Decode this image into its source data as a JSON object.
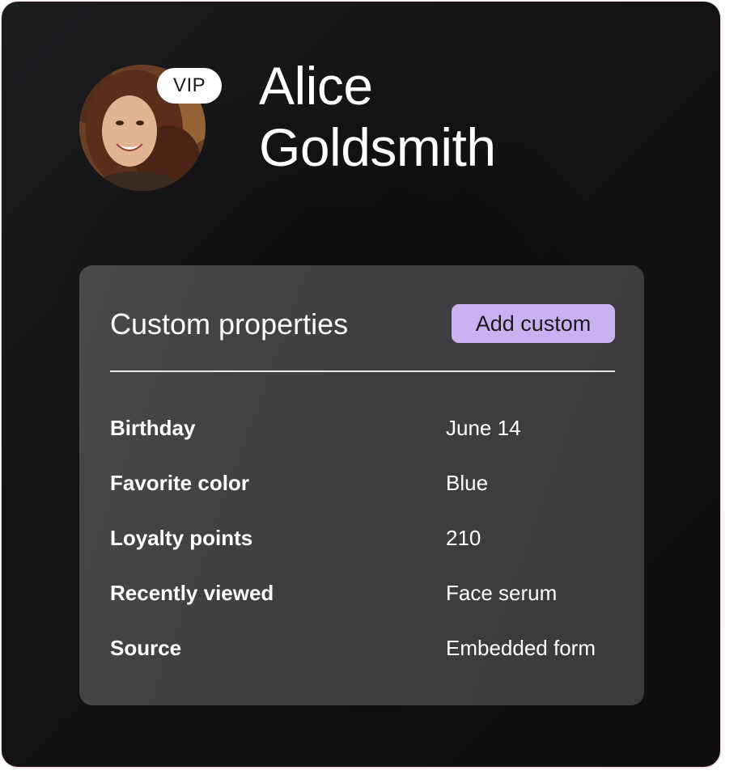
{
  "profile": {
    "badge": "VIP",
    "first_name": "Alice",
    "last_name": "Goldsmith"
  },
  "card": {
    "title": "Custom properties",
    "add_button_label": "Add custom",
    "accent_color": "#c9b0f0",
    "properties": [
      {
        "label": "Birthday",
        "value": "June 14"
      },
      {
        "label": "Favorite color",
        "value": "Blue"
      },
      {
        "label": "Loyalty points",
        "value": "210"
      },
      {
        "label": "Recently viewed",
        "value": "Face serum"
      },
      {
        "label": "Source",
        "value": "Embedded form"
      }
    ]
  }
}
